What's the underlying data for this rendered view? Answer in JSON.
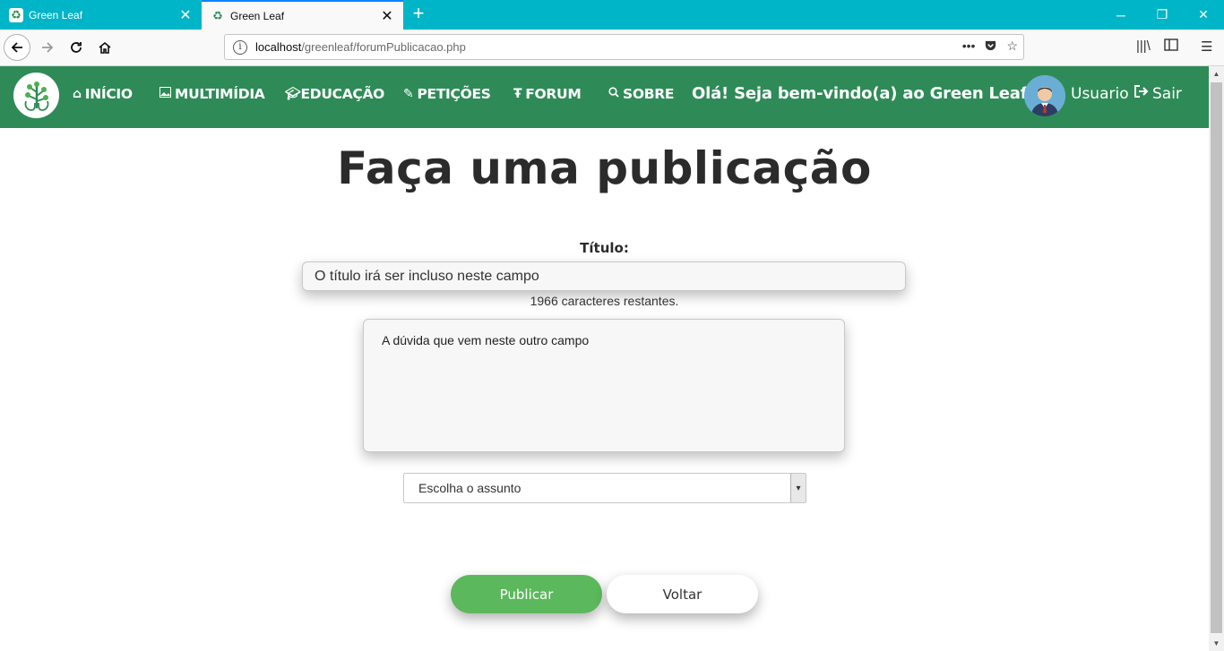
{
  "browser": {
    "tabs": [
      {
        "title": "Green Leaf",
        "active": false
      },
      {
        "title": "Green Leaf",
        "active": true
      }
    ],
    "url_host": "localhost",
    "url_path": "/greenleaf/forumPublicacao.php",
    "url_actions": [
      "•••",
      "pocket",
      "☆"
    ]
  },
  "site_nav": {
    "items": [
      {
        "icon": "home-icon",
        "label": "INÍCIO"
      },
      {
        "icon": "image-icon",
        "label": "MULTIMÍDIA"
      },
      {
        "icon": "graduation-cap-icon",
        "label": "EDUCAÇÃO"
      },
      {
        "icon": "pencil-icon",
        "label": "PETIÇÕES"
      },
      {
        "icon": "text-icon",
        "label": "FORUM"
      },
      {
        "icon": "search-icon",
        "label": "SOBRE"
      }
    ],
    "welcome": "Olá! Seja bem-vindo(a) ao Green Leaf ,",
    "username": "Usuario",
    "logout": "Sair"
  },
  "form": {
    "page_title": "Faça uma publicação",
    "title_label": "Título:",
    "title_value": "O título irá ser incluso neste campo",
    "char_count": "1966 caracteres restantes.",
    "question_value": "A dúvida que vem neste outro campo",
    "subject_selected": "Escolha o assunto",
    "publish_label": "Publicar",
    "back_label": "Voltar"
  },
  "colors": {
    "tabbar": "#00b5c7",
    "site_nav": "#2e8b57",
    "publish_button": "#5cb85c"
  }
}
